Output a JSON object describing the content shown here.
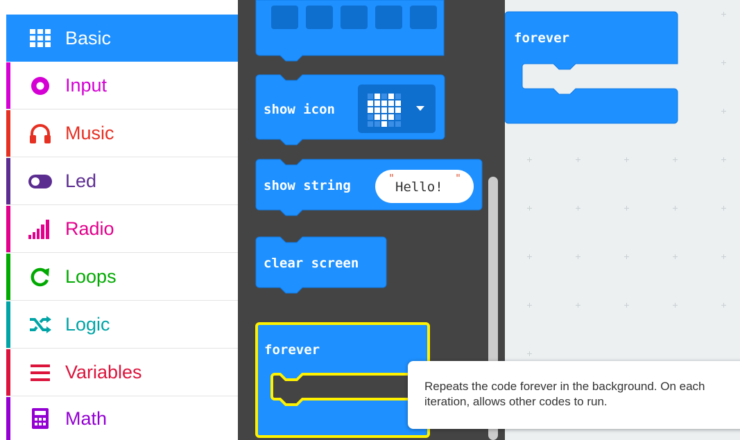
{
  "categories": [
    {
      "label": "Basic",
      "color": "#1e90ff",
      "icon": "grid-icon",
      "selected": true
    },
    {
      "label": "Input",
      "color": "#d400d4",
      "icon": "input-circle-icon"
    },
    {
      "label": "Music",
      "color": "#e63022",
      "icon": "headphones-icon"
    },
    {
      "label": "Led",
      "color": "#5c2d91",
      "icon": "toggle-icon"
    },
    {
      "label": "Radio",
      "color": "#e3008c",
      "icon": "signal-bars-icon"
    },
    {
      "label": "Loops",
      "color": "#00aa00",
      "icon": "loop-arrow-icon"
    },
    {
      "label": "Logic",
      "color": "#00a4a6",
      "icon": "shuffle-icon"
    },
    {
      "label": "Variables",
      "color": "#dc143c",
      "icon": "lines-icon"
    },
    {
      "label": "Math",
      "color": "#9400d3",
      "icon": "calculator-icon"
    }
  ],
  "flyout": {
    "show_icon": "show icon",
    "show_string": "show string",
    "string_value": "Hello!",
    "clear_screen": "clear screen",
    "forever": "forever"
  },
  "workspace": {
    "forever": "forever"
  },
  "tooltip": "Repeats the code forever in the background. On each iteration, allows other codes to run.",
  "colors": {
    "block": "#1e90ff",
    "block_border": "#0f7ae5",
    "highlight": "#fff200",
    "flyout_bg": "#444444",
    "workspace_bg": "#ecf0f1"
  }
}
